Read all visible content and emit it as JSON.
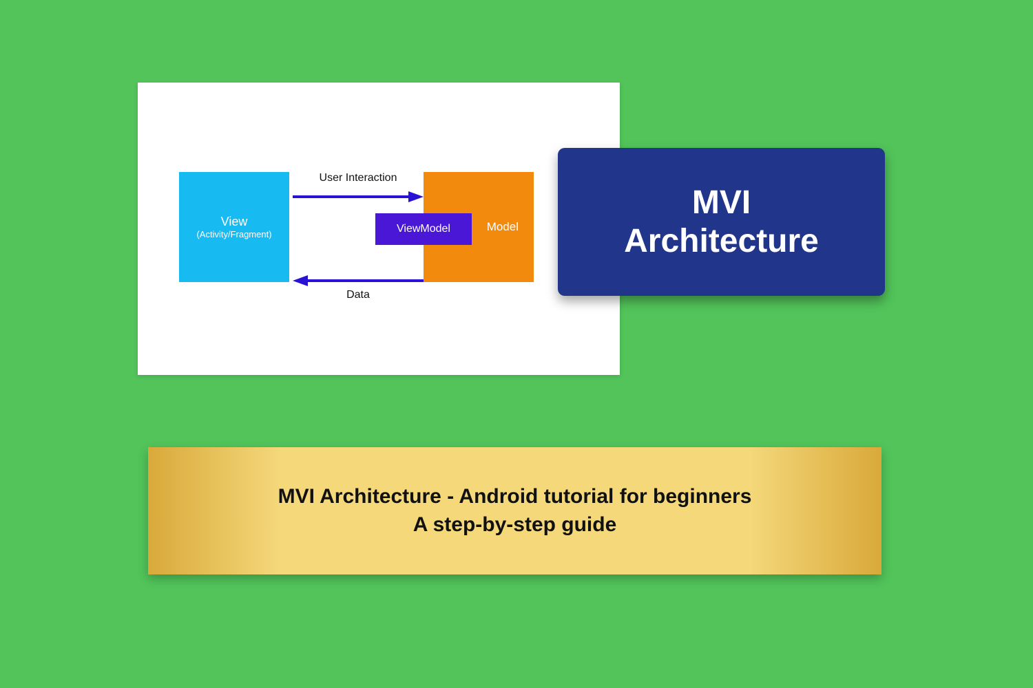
{
  "diagram": {
    "view": {
      "title": "View",
      "subtitle": "(Activity/Fragment)"
    },
    "model": {
      "label": "Model"
    },
    "viewmodel": {
      "label": "ViewModel"
    },
    "arrow_top_label": "User Interaction",
    "arrow_bottom_label": "Data"
  },
  "title_card": {
    "line1": "MVI",
    "line2": "Architecture"
  },
  "caption": {
    "line1": "MVI Architecture - Android tutorial for beginners",
    "line2": "A step-by-step guide"
  },
  "colors": {
    "bg": "#52c45a",
    "view": "#18baf2",
    "model": "#f28a0e",
    "viewmodel": "#4b17d6",
    "arrow": "#2a12d4",
    "title_card": "#21368a"
  }
}
